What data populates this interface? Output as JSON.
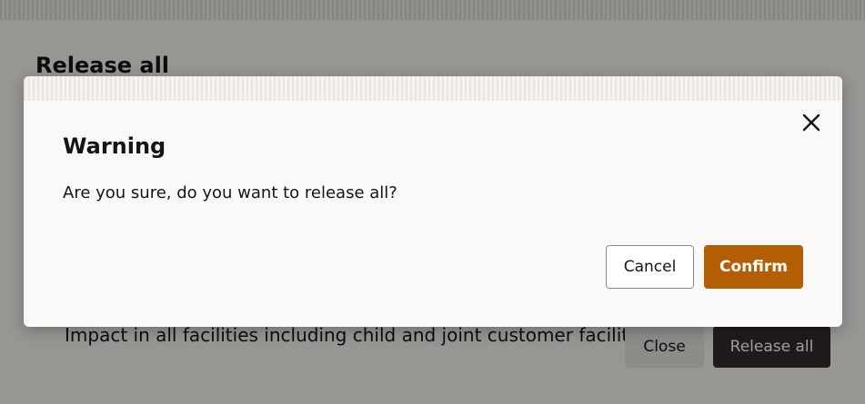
{
  "background_page": {
    "title": "Release all",
    "impact_text": "Impact in all facilities including child and joint customer facilities",
    "close_label": "Close",
    "release_all_label": "Release all"
  },
  "dialog": {
    "title": "Warning",
    "message": "Are you sure, do you want to release all?",
    "cancel_label": "Cancel",
    "confirm_label": "Confirm",
    "close_icon": "close-icon"
  },
  "colors": {
    "confirm_bg": "#b35e05",
    "release_all_bg": "#312d2a"
  }
}
